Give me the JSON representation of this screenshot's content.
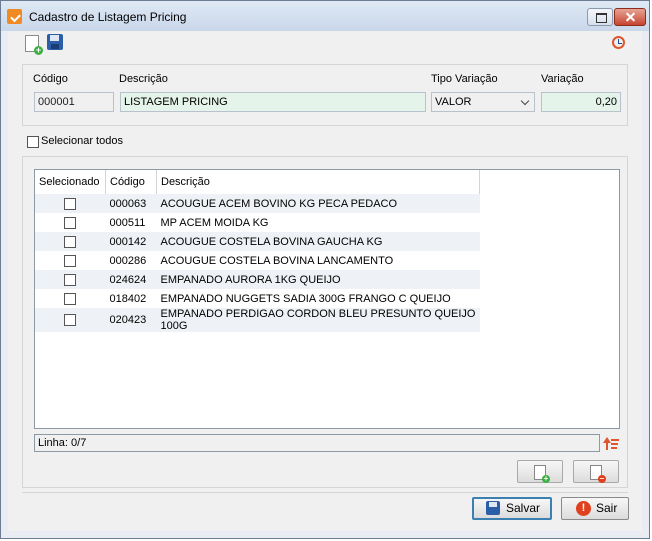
{
  "window": {
    "title": "Cadastro de Listagem Pricing"
  },
  "form": {
    "codigo_label": "Código",
    "descricao_label": "Descrição",
    "tipo_label": "Tipo Variação",
    "variacao_label": "Variação",
    "codigo": "000001",
    "descricao": "LISTAGEM PRICING",
    "tipo": "VALOR",
    "variacao": "0,20"
  },
  "select_all": {
    "label": "Selecionar todos",
    "checked": false
  },
  "grid": {
    "columns": [
      "Selecionado",
      "Código",
      "Descrição"
    ],
    "rows": [
      {
        "codigo": "000063",
        "descricao": "ACOUGUE ACEM BOVINO KG PECA PEDACO",
        "selected": false
      },
      {
        "codigo": "000511",
        "descricao": "MP ACEM MOIDA KG",
        "selected": false
      },
      {
        "codigo": "000142",
        "descricao": "ACOUGUE COSTELA BOVINA GAUCHA KG",
        "selected": false
      },
      {
        "codigo": "000286",
        "descricao": "ACOUGUE COSTELA BOVINA LANCAMENTO",
        "selected": false
      },
      {
        "codigo": "024624",
        "descricao": "EMPANADO AURORA 1KG QUEIJO",
        "selected": false
      },
      {
        "codigo": "018402",
        "descricao": "EMPANADO NUGGETS SADIA 300G FRANGO C QUEIJO",
        "selected": false
      },
      {
        "codigo": "020423",
        "descricao": "EMPANADO PERDIGAO CORDON BLEU PRESUNTO QUEIJO 100G",
        "selected": false
      }
    ]
  },
  "status": {
    "linha": "Linha: 0/7"
  },
  "buttons": {
    "salvar": "Salvar",
    "sair": "Sair"
  },
  "icons": {
    "new": "new-document-icon",
    "save": "save-icon",
    "history": "clock-icon",
    "sort": "sort-icon",
    "add": "add-row-icon",
    "remove": "remove-row-icon",
    "exit": "exit-icon"
  },
  "colors": {
    "accent": "#3c7fb1",
    "field_green": "#e4f4ea",
    "exit_red": "#e0401e"
  }
}
